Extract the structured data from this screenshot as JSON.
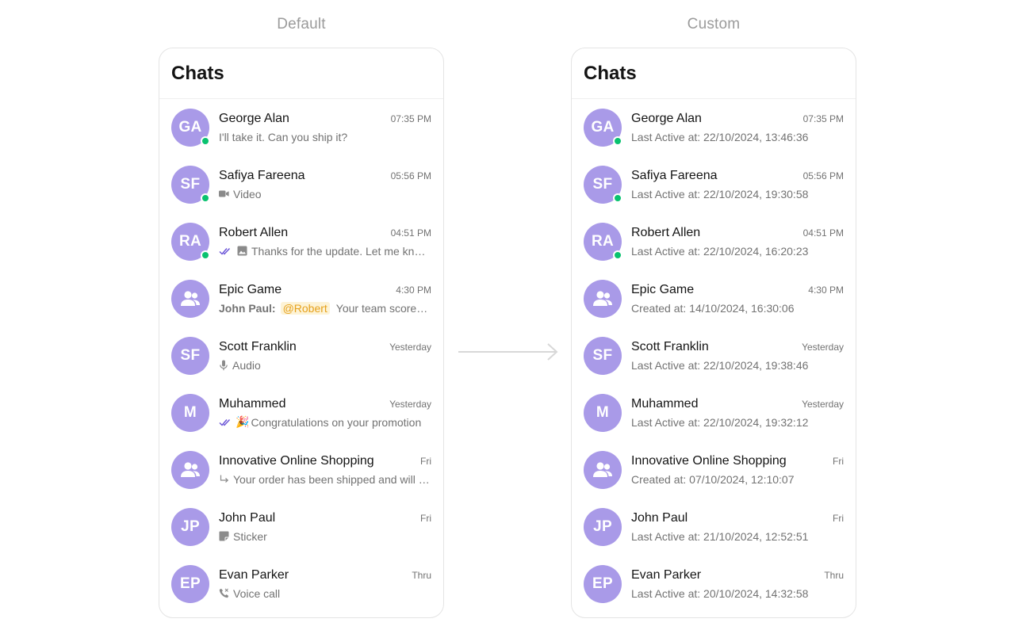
{
  "labels": {
    "left": "Default",
    "right": "Custom"
  },
  "title": "Chats",
  "colors": {
    "avatar": "#a99ae8",
    "online": "#09c26f",
    "receipt": "#6852d6",
    "mention_bg": "#fdf3d6",
    "mention_text": "#e6a11c"
  },
  "default_chats": [
    {
      "name": "George Alan",
      "time": "07:35 PM",
      "initials": "GA",
      "online": true,
      "icon": "none",
      "text": "I'll take it. Can you ship it?"
    },
    {
      "name": "Safiya Fareena",
      "time": "05:56 PM",
      "initials": "SF",
      "online": true,
      "icon": "video-icon",
      "text": "Video"
    },
    {
      "name": "Robert Allen",
      "time": "04:51 PM",
      "initials": "RA",
      "online": true,
      "icon": "read-receipt-icon+image-icon",
      "text": "Thanks for the update. Let me know..."
    },
    {
      "name": "Epic Game",
      "time": "4:30 PM",
      "initials": "",
      "group": true,
      "online": false,
      "sender": "John Paul:",
      "mention": "@Robert",
      "text": "Your team scored again!"
    },
    {
      "name": "Scott Franklin",
      "time": "Yesterday",
      "initials": "SF",
      "online": false,
      "icon": "microphone-icon",
      "text": "Audio"
    },
    {
      "name": "Muhammed",
      "time": "Yesterday",
      "initials": "M",
      "online": false,
      "icon": "read-receipt-icon",
      "emoji": "🎉",
      "text": "Congratulations on your promotion"
    },
    {
      "name": "Innovative Online Shopping",
      "time": "Fri",
      "initials": "",
      "group": true,
      "online": false,
      "icon": "reply-arrow-icon",
      "text": "Your order has been shipped and will arrive soon"
    },
    {
      "name": "John Paul",
      "time": "Fri",
      "initials": "JP",
      "online": false,
      "icon": "sticker-icon",
      "text": "Sticker"
    },
    {
      "name": "Evan Parker",
      "time": "Thru",
      "initials": "EP",
      "online": false,
      "icon": "phone-icon",
      "text": "Voice call"
    }
  ],
  "custom_chats": [
    {
      "name": "George Alan",
      "time": "07:35 PM",
      "initials": "GA",
      "online": true,
      "text": "Last Active at: 22/10/2024, 13:46:36"
    },
    {
      "name": "Safiya Fareena",
      "time": "05:56 PM",
      "initials": "SF",
      "online": true,
      "text": "Last Active at: 22/10/2024, 19:30:58"
    },
    {
      "name": "Robert Allen",
      "time": "04:51 PM",
      "initials": "RA",
      "online": true,
      "text": "Last Active at: 22/10/2024, 16:20:23"
    },
    {
      "name": "Epic Game",
      "time": "4:30 PM",
      "initials": "",
      "group": true,
      "online": false,
      "text": "Created at: 14/10/2024, 16:30:06"
    },
    {
      "name": "Scott Franklin",
      "time": "Yesterday",
      "initials": "SF",
      "online": false,
      "text": "Last Active at: 22/10/2024, 19:38:46"
    },
    {
      "name": "Muhammed",
      "time": "Yesterday",
      "initials": "M",
      "online": false,
      "text": "Last Active at: 22/10/2024, 19:32:12"
    },
    {
      "name": "Innovative Online Shopping",
      "time": "Fri",
      "initials": "",
      "group": true,
      "online": false,
      "text": "Created at: 07/10/2024, 12:10:07"
    },
    {
      "name": "John Paul",
      "time": "Fri",
      "initials": "JP",
      "online": false,
      "text": "Last Active at: 21/10/2024, 12:52:51"
    },
    {
      "name": "Evan Parker",
      "time": "Thru",
      "initials": "EP",
      "online": false,
      "text": "Last Active at: 20/10/2024, 14:32:58"
    }
  ]
}
